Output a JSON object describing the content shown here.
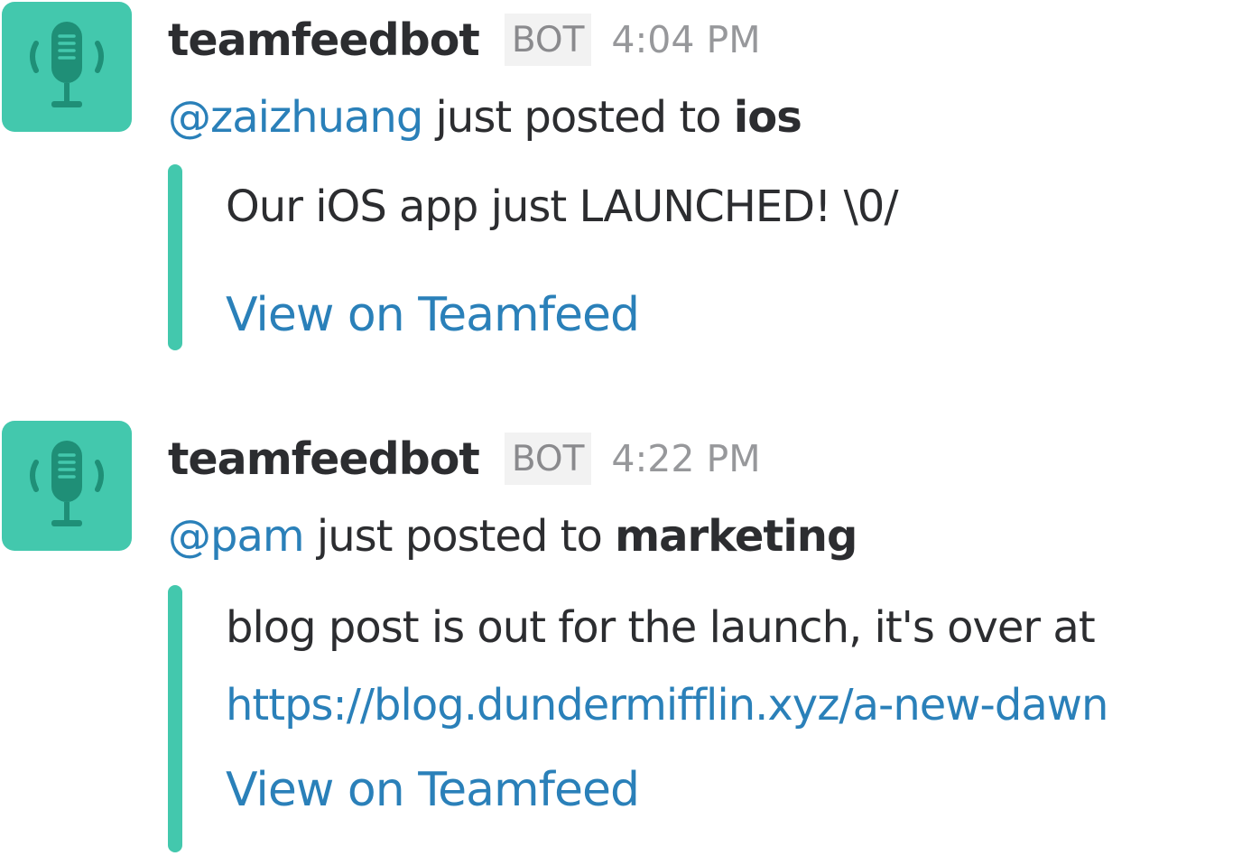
{
  "messages": [
    {
      "username": "teamfeedbot",
      "badge": "BOT",
      "time": "4:04 PM",
      "author_mention": "@zaizhuang",
      "action_text": " just posted to ",
      "channel": "ios",
      "attachment": {
        "text": "Our iOS app just LAUNCHED! \\0/",
        "link": "",
        "view_label": "View on Teamfeed"
      }
    },
    {
      "username": "teamfeedbot",
      "badge": "BOT",
      "time": "4:22 PM",
      "author_mention": "@pam",
      "action_text": " just posted to ",
      "channel": "marketing",
      "attachment": {
        "text": "blog post is out for the launch, it's over at",
        "link": "https://blog.dundermifflin.xyz/a-new-dawn",
        "view_label": "View on Teamfeed"
      }
    }
  ],
  "colors": {
    "accent": "#43c8ad",
    "link": "#2a80b9",
    "text": "#2c2d30",
    "muted": "#97989b"
  },
  "icons": {
    "avatar": "microphone-icon"
  }
}
